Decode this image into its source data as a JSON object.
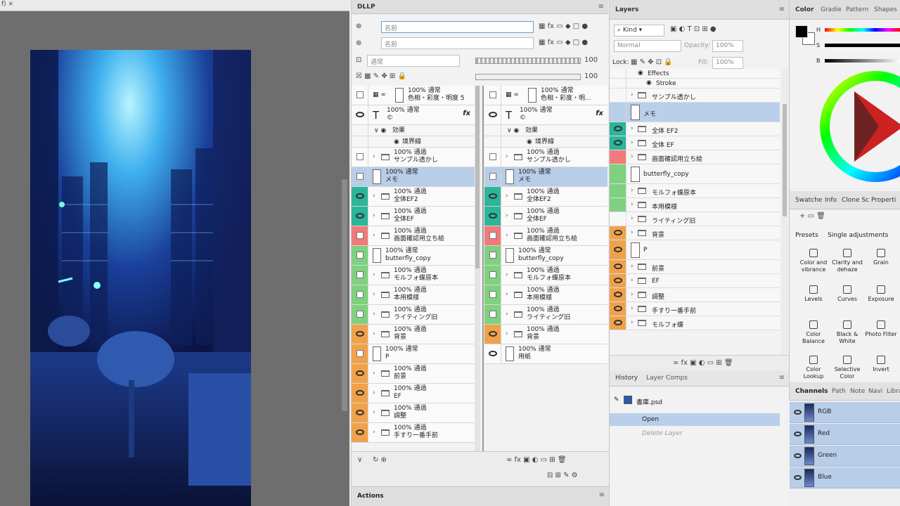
{
  "canvas": {
    "tab_label": "f) ×"
  },
  "dllp": {
    "title": "DLLP",
    "search1_value": "名前",
    "search2_value": "名前",
    "blend_mode": "通常",
    "opacity_a": "100",
    "opacity_b": "100",
    "left_rows": [
      {
        "l1": "100% 通常",
        "l2": "色相・彩度・明度 5",
        "vis": "box",
        "kind": "adj",
        "color": ""
      },
      {
        "l1": "100% 通常",
        "l2": "©",
        "vis": "eye",
        "kind": "text",
        "color": "",
        "fx": "fx"
      },
      {
        "l1": "効果",
        "l2": "",
        "vis": "none",
        "kind": "effect",
        "color": ""
      },
      {
        "l1": "境界線",
        "l2": "",
        "vis": "none",
        "kind": "effect2",
        "color": ""
      },
      {
        "l1": "100% 通過",
        "l2": "サンプル透かし",
        "vis": "box",
        "kind": "folder",
        "color": ""
      },
      {
        "l1": "100% 通常",
        "l2": "メモ",
        "vis": "box",
        "kind": "thumb",
        "color": "",
        "sel": true
      },
      {
        "l1": "100% 通過",
        "l2": "全体EF2",
        "vis": "eye",
        "kind": "folder",
        "color": "teal"
      },
      {
        "l1": "100% 通過",
        "l2": "全体EF",
        "vis": "eye",
        "kind": "folder",
        "color": "teal"
      },
      {
        "l1": "100% 通過",
        "l2": "画面確認用立ち絵",
        "vis": "box",
        "kind": "folder",
        "color": "red"
      },
      {
        "l1": "100% 通常",
        "l2": "butterfly_copy",
        "vis": "box",
        "kind": "thumb",
        "color": "green"
      },
      {
        "l1": "100% 通過",
        "l2": "モルフォ蝶原本",
        "vis": "box",
        "kind": "folder",
        "color": "green"
      },
      {
        "l1": "100% 通過",
        "l2": "本用模様",
        "vis": "box",
        "kind": "folder",
        "color": "green"
      },
      {
        "l1": "100% 通過",
        "l2": "ライティング旧",
        "vis": "box",
        "kind": "folder",
        "color": "green"
      },
      {
        "l1": "100% 通過",
        "l2": "背景",
        "vis": "eye",
        "kind": "folder",
        "color": "orange"
      },
      {
        "l1": "100% 通常",
        "l2": "P",
        "vis": "box",
        "kind": "thumb",
        "color": "orange"
      },
      {
        "l1": "100% 通過",
        "l2": "前景",
        "vis": "eye",
        "kind": "folder",
        "color": "orange"
      },
      {
        "l1": "100% 通過",
        "l2": "EF",
        "vis": "eye",
        "kind": "folder",
        "color": "orange"
      },
      {
        "l1": "100% 通過",
        "l2": "調整",
        "vis": "eye",
        "kind": "folder",
        "color": "orange"
      },
      {
        "l1": "100% 通過",
        "l2": "手すり一番手前",
        "vis": "eye",
        "kind": "folder",
        "color": "orange"
      }
    ],
    "right_rows": [
      {
        "l1": "100% 通常",
        "l2": "色相・彩度・明...",
        "vis": "box",
        "kind": "adj",
        "color": ""
      },
      {
        "l1": "100% 通常",
        "l2": "©",
        "vis": "eye",
        "kind": "text",
        "color": "",
        "fx": "fx"
      },
      {
        "l1": "効果",
        "l2": "",
        "vis": "none",
        "kind": "effect",
        "color": ""
      },
      {
        "l1": "境界線",
        "l2": "",
        "vis": "none",
        "kind": "effect2",
        "color": ""
      },
      {
        "l1": "100% 通過",
        "l2": "サンプル透かし",
        "vis": "box",
        "kind": "folder",
        "color": ""
      },
      {
        "l1": "100% 通常",
        "l2": "メモ",
        "vis": "box",
        "kind": "thumb",
        "color": "",
        "sel": true
      },
      {
        "l1": "100% 通過",
        "l2": "全体EF2",
        "vis": "eye",
        "kind": "folder",
        "color": "teal"
      },
      {
        "l1": "100% 通過",
        "l2": "全体EF",
        "vis": "eye",
        "kind": "folder",
        "color": "teal"
      },
      {
        "l1": "100% 通過",
        "l2": "画面確認用立ち絵",
        "vis": "box",
        "kind": "folder",
        "color": "red"
      },
      {
        "l1": "100% 通常",
        "l2": "butterfly_copy",
        "vis": "box",
        "kind": "thumb",
        "color": "green"
      },
      {
        "l1": "100% 通過",
        "l2": "モルフォ蝶原本",
        "vis": "box",
        "kind": "folder",
        "color": "green"
      },
      {
        "l1": "100% 通過",
        "l2": "本用模様",
        "vis": "box",
        "kind": "folder",
        "color": "green"
      },
      {
        "l1": "100% 通過",
        "l2": "ライティング旧",
        "vis": "box",
        "kind": "folder",
        "color": "green"
      },
      {
        "l1": "100% 通過",
        "l2": "背景",
        "vis": "eye",
        "kind": "folder",
        "color": "orange"
      },
      {
        "l1": "100% 通常",
        "l2": "用紙",
        "vis": "eye",
        "kind": "thumb",
        "color": ""
      }
    ]
  },
  "layers": {
    "title": "Layers",
    "kind": "Kind",
    "blend": "Normal",
    "opacity_label": "Opacity:",
    "opacity": "100%",
    "lock_label": "Lock:",
    "fill_label": "Fill:",
    "fill": "100%",
    "rows": [
      {
        "label": "Effects",
        "kind": "eff",
        "color": ""
      },
      {
        "label": "Stroke",
        "kind": "eff2",
        "color": ""
      },
      {
        "label": "サンプル透かし",
        "kind": "folder",
        "color": ""
      },
      {
        "label": "メモ",
        "kind": "thumb",
        "color": "",
        "sel": true
      },
      {
        "label": "全体 EF2",
        "kind": "folder",
        "color": "teal"
      },
      {
        "label": "全体 EF",
        "kind": "folder",
        "color": "teal"
      },
      {
        "label": "画面確認用立ち絵",
        "kind": "folder",
        "color": "red"
      },
      {
        "label": "butterfly_copy",
        "kind": "thumb",
        "color": "green"
      },
      {
        "label": "モルフォ蝶原本",
        "kind": "folder",
        "color": "green"
      },
      {
        "label": "本用模様",
        "kind": "folder",
        "color": "green"
      },
      {
        "label": "ライティング旧",
        "kind": "folder",
        "color": ""
      },
      {
        "label": "背景",
        "kind": "folder",
        "color": "orange"
      },
      {
        "label": "P",
        "kind": "thumb",
        "color": "orange"
      },
      {
        "label": "前景",
        "kind": "folder",
        "color": "orange"
      },
      {
        "label": "EF",
        "kind": "folder",
        "color": "orange"
      },
      {
        "label": "調整",
        "kind": "folder",
        "color": "orange"
      },
      {
        "label": "手すり一番手前",
        "kind": "folder",
        "color": "orange"
      },
      {
        "label": "モルフォ蝶",
        "kind": "folder",
        "color": "orange"
      }
    ]
  },
  "history": {
    "tab1": "History",
    "tab2": "Layer Comps",
    "doc": "書庫.psd",
    "items": [
      "Open",
      "Delete Layer"
    ]
  },
  "actions": {
    "title": "Actions"
  },
  "color_panel": {
    "tabs": [
      "Color",
      "Gradie",
      "Pattern",
      "Shapes"
    ],
    "h": "H",
    "s": "S",
    "b": "B",
    "fg": "#000000",
    "bg": "#ffffff"
  },
  "adjust": {
    "tabs": [
      "Swatche",
      "Info",
      "Clone Sc",
      "Properti"
    ],
    "presets": "Presets",
    "single": "Single adjustments",
    "items": [
      "Color and vibrance",
      "Clarity and dehaze",
      "Grain",
      "Levels",
      "Curves",
      "Exposure",
      "Color Balance",
      "Black & White",
      "Photo Filter",
      "Color Lookup",
      "Selective Color",
      "Invert"
    ]
  },
  "channels": {
    "tabs": [
      "Channels",
      "Path",
      "Note",
      "Navi",
      "Libra"
    ],
    "items": [
      "RGB",
      "Red",
      "Green",
      "Blue"
    ]
  }
}
